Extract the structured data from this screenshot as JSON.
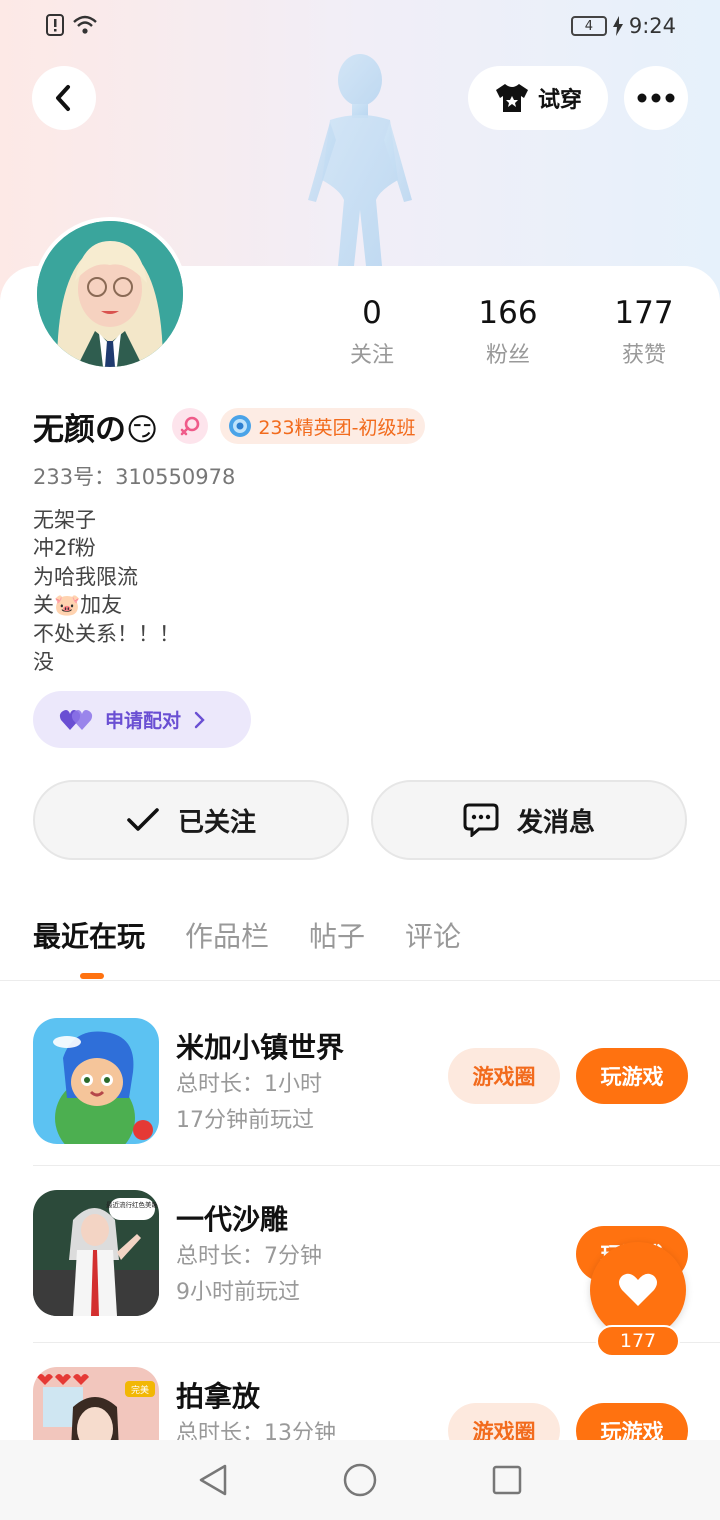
{
  "status_bar": {
    "battery": "4",
    "time": "9:24"
  },
  "header": {
    "try_on_label": "试穿"
  },
  "profile": {
    "stats": [
      {
        "count": "0",
        "label": "关注"
      },
      {
        "count": "166",
        "label": "粉丝"
      },
      {
        "count": "177",
        "label": "获赞"
      }
    ],
    "name": "无颜の😏",
    "badge": "233精英团-初级班",
    "uid": "233号：310550978",
    "bio_lines": [
      "无架子",
      "冲2f粉",
      "为哈我限流",
      "关🐷加友",
      "不处关系！！！",
      "没"
    ],
    "pair_button": "申请配对"
  },
  "actions": {
    "follow": "已关注",
    "message": "发消息"
  },
  "tabs": [
    "最近在玩",
    "作品栏",
    "帖子",
    "评论"
  ],
  "games": [
    {
      "title": "米加小镇世界",
      "duration": "总时长：1小时",
      "last_played": "17分钟前玩过",
      "circle_btn": "游戏圈",
      "play_btn": "玩游戏"
    },
    {
      "title": "一代沙雕",
      "duration": "总时长：7分钟",
      "last_played": "9小时前玩过",
      "circle_btn": "",
      "play_btn": "玩游戏",
      "icon_caption": "最近流行红色美瞳"
    },
    {
      "title": "拍拿放",
      "duration": "总时长：13分钟",
      "last_played": "",
      "circle_btn": "游戏圈",
      "play_btn": "玩游戏",
      "icon_caption": "完美"
    }
  ],
  "like_fab": {
    "count": "177"
  }
}
